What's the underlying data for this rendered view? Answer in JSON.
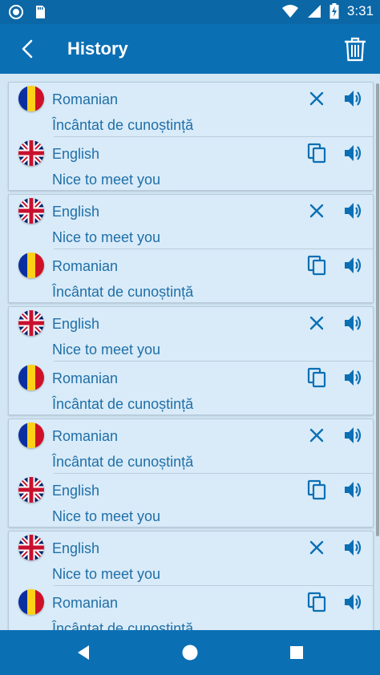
{
  "status_bar": {
    "time": "3:31"
  },
  "app_bar": {
    "title": "History"
  },
  "cards": [
    {
      "source": {
        "flag": "romanian",
        "language": "Romanian",
        "text": "Încântat de cunoștință"
      },
      "target": {
        "flag": "english",
        "language": "English",
        "text": "Nice to meet you"
      }
    },
    {
      "source": {
        "flag": "english",
        "language": "English",
        "text": "Nice to meet you"
      },
      "target": {
        "flag": "romanian",
        "language": "Romanian",
        "text": "Încântat de cunoștință"
      }
    },
    {
      "source": {
        "flag": "english",
        "language": "English",
        "text": "Nice to meet you"
      },
      "target": {
        "flag": "romanian",
        "language": "Romanian",
        "text": "Încântat de cunoștință"
      }
    },
    {
      "source": {
        "flag": "romanian",
        "language": "Romanian",
        "text": "Încântat de cunoștință"
      },
      "target": {
        "flag": "english",
        "language": "English",
        "text": "Nice to meet you"
      }
    },
    {
      "source": {
        "flag": "english",
        "language": "English",
        "text": "Nice to meet you"
      },
      "target": {
        "flag": "romanian",
        "language": "Romanian",
        "text": "Încântat de cunoștință"
      }
    }
  ],
  "icons": {
    "back": "arrow-back-icon",
    "delete": "trash-icon",
    "remove": "close-icon",
    "copy": "copy-icon",
    "speak": "speaker-icon"
  },
  "colors": {
    "app_bar": "#0b6fb4",
    "status_bar": "#0b67a6",
    "background": "#d2e6f4",
    "card": "#d9ebf8",
    "accent_text": "#1f6fa8"
  }
}
